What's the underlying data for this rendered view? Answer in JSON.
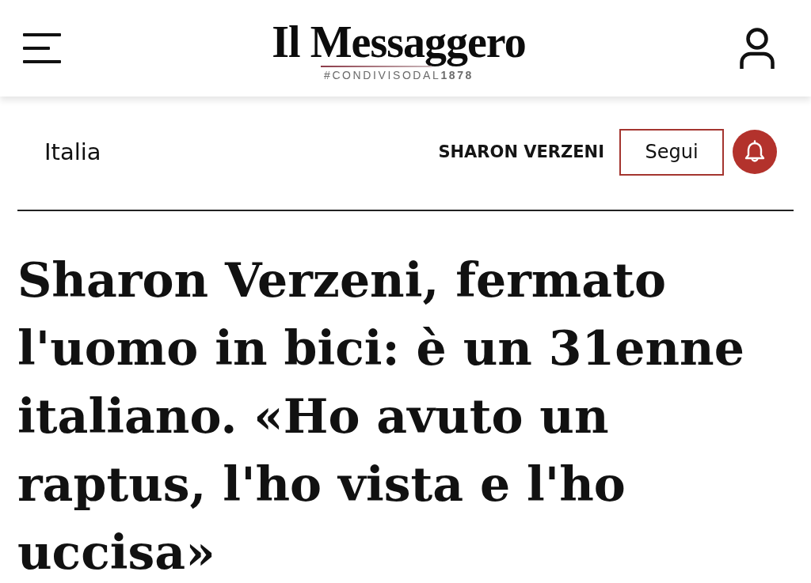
{
  "header": {
    "logo": {
      "title": "Il Messaggero",
      "tagline": "#CONDIVISODAL**1878**"
    }
  },
  "topic_bar": {
    "section": "Italia",
    "tag": {
      "name": "SHARON VERZENI",
      "follow_button": "Segui"
    }
  },
  "article": {
    "headline": "Sharon Verzeni, fermato l'uomo in bici: è un 31enne italiano. «Ho avuto un raptus, l'ho vista e l'ho uccisa»"
  }
}
